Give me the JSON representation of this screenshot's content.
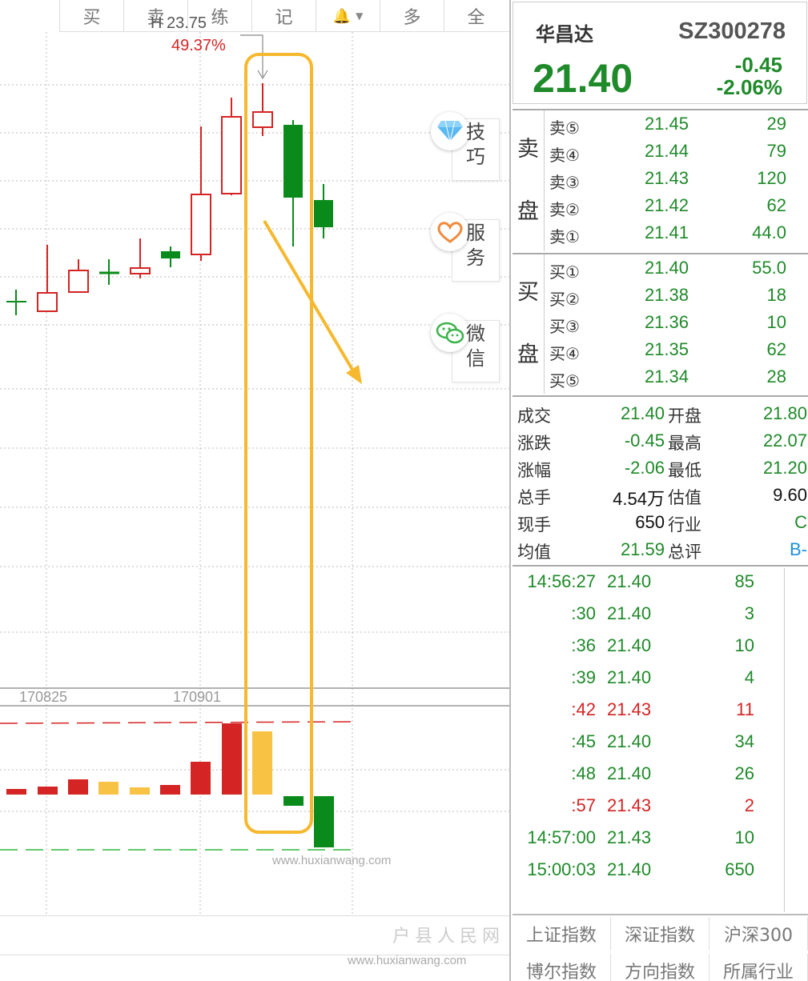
{
  "toolbar": {
    "items": [
      {
        "label": "买"
      },
      {
        "label": "卖"
      },
      {
        "label": "练"
      },
      {
        "label": "记"
      },
      {
        "label": "",
        "icon": "bell-icon"
      },
      {
        "label": "多"
      },
      {
        "label": "全"
      }
    ]
  },
  "chart": {
    "high_label": "H 23.75",
    "high_pct": "49.37%",
    "dates": [
      "170825",
      "170901"
    ],
    "watermark": "www.huxianwang.com",
    "site_name": "户县人民网",
    "colors": {
      "up": "#d42424",
      "down": "#0a8a1a",
      "highlight": "#f5b82e"
    }
  },
  "side_tools": [
    {
      "label": "技巧",
      "icon": "diamond-icon"
    },
    {
      "label": "服务",
      "icon": "heart-icon"
    },
    {
      "label": "微信",
      "icon": "wechat-icon"
    }
  ],
  "stock": {
    "name": "华昌达",
    "code": "SZ300278",
    "price": "21.40",
    "change": "-0.45",
    "change_pct": "-2.06%"
  },
  "order_book": {
    "sell_label": [
      "卖",
      "盘"
    ],
    "buy_label": [
      "买",
      "盘"
    ],
    "sell": [
      {
        "level": "卖⑤",
        "price": "21.45",
        "volume": "29"
      },
      {
        "level": "卖④",
        "price": "21.44",
        "volume": "79"
      },
      {
        "level": "卖③",
        "price": "21.43",
        "volume": "120"
      },
      {
        "level": "卖②",
        "price": "21.42",
        "volume": "62"
      },
      {
        "level": "卖①",
        "price": "21.41",
        "volume": "44.0"
      }
    ],
    "buy": [
      {
        "level": "买①",
        "price": "21.40",
        "volume": "55.0"
      },
      {
        "level": "买②",
        "price": "21.38",
        "volume": "18"
      },
      {
        "level": "买③",
        "price": "21.36",
        "volume": "10"
      },
      {
        "level": "买④",
        "price": "21.35",
        "volume": "62"
      },
      {
        "level": "买⑤",
        "price": "21.34",
        "volume": "28"
      }
    ]
  },
  "stats": [
    {
      "k1": "成交",
      "v1": "21.40",
      "c1": "green",
      "k2": "开盘",
      "v2": "21.80",
      "c2": "green"
    },
    {
      "k1": "涨跌",
      "v1": "-0.45",
      "c1": "green",
      "k2": "最高",
      "v2": "22.07",
      "c2": "green"
    },
    {
      "k1": "涨幅",
      "v1": "-2.06",
      "c1": "green",
      "k2": "最低",
      "v2": "21.20",
      "c2": "green"
    },
    {
      "k1": "总手",
      "v1": "4.54万",
      "c1": "black",
      "k2": "估值",
      "v2": "9.60",
      "c2": "black"
    },
    {
      "k1": "现手",
      "v1": "650",
      "c1": "black",
      "k2": "行业",
      "v2": "C",
      "c2": "green"
    },
    {
      "k1": "均值",
      "v1": "21.59",
      "c1": "green",
      "k2": "总评",
      "v2": "B-",
      "c2": "blue"
    }
  ],
  "ticks": [
    {
      "time": "14:56:27",
      "price": "21.40",
      "volume": "85",
      "color": "green"
    },
    {
      "time": ":30",
      "price": "21.40",
      "volume": "3",
      "color": "green"
    },
    {
      "time": ":36",
      "price": "21.40",
      "volume": "10",
      "color": "green"
    },
    {
      "time": ":39",
      "price": "21.40",
      "volume": "4",
      "color": "green"
    },
    {
      "time": ":42",
      "price": "21.43",
      "volume": "11",
      "color": "red"
    },
    {
      "time": ":45",
      "price": "21.40",
      "volume": "34",
      "color": "green"
    },
    {
      "time": ":48",
      "price": "21.40",
      "volume": "26",
      "color": "green"
    },
    {
      "time": ":57",
      "price": "21.43",
      "volume": "2",
      "color": "red"
    },
    {
      "time": "14:57:00",
      "price": "21.43",
      "volume": "10",
      "color": "green"
    },
    {
      "time": "15:00:03",
      "price": "21.40",
      "volume": "650",
      "color": "green"
    }
  ],
  "index_tabs": [
    "上证指数",
    "深证指数",
    "沪深300",
    "博尔指数",
    "方向指数",
    "所属行业"
  ],
  "chart_data": {
    "type": "candlestick",
    "candles": [
      {
        "open": 0,
        "close": 0,
        "high": 0,
        "low": 0,
        "dir": "doji-down"
      }
    ],
    "volume_colors": [
      "red",
      "red",
      "red",
      "yellow",
      "yellow",
      "red",
      "red",
      "red",
      "yellow",
      "green",
      "green"
    ]
  }
}
